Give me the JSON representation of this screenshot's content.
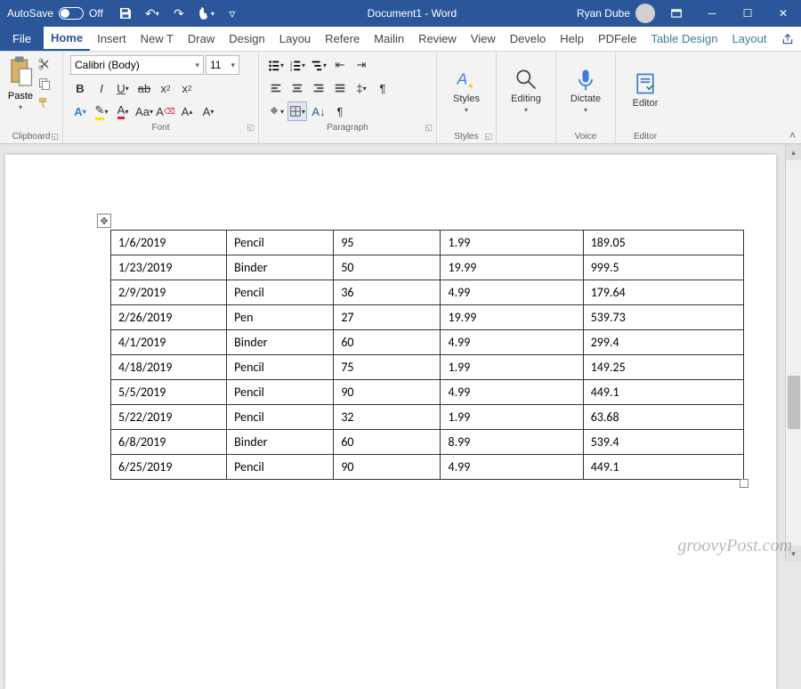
{
  "titlebar": {
    "autosave_label": "AutoSave",
    "autosave_state": "Off",
    "doc_title": "Document1  -  Word",
    "user_name": "Ryan Dube"
  },
  "tabs": {
    "file": "File",
    "items": [
      "Home",
      "Insert",
      "New T",
      "Draw",
      "Design",
      "Layou",
      "Refere",
      "Mailin",
      "Review",
      "View",
      "Develo",
      "Help",
      "PDFele"
    ],
    "contextual": [
      "Table Design",
      "Layout"
    ]
  },
  "ribbon": {
    "clipboard": {
      "paste": "Paste",
      "label": "Clipboard"
    },
    "font": {
      "name": "Calibri (Body)",
      "size": "11",
      "label": "Font"
    },
    "paragraph": {
      "label": "Paragraph"
    },
    "styles": {
      "btn": "Styles",
      "label": "Styles"
    },
    "editing": {
      "btn": "Editing"
    },
    "voice": {
      "btn": "Dictate",
      "label": "Voice"
    },
    "editor": {
      "btn": "Editor",
      "label": "Editor"
    }
  },
  "table": {
    "rows": [
      [
        "1/6/2019",
        "Pencil",
        "95",
        "1.99",
        "189.05"
      ],
      [
        "1/23/2019",
        "Binder",
        "50",
        "19.99",
        "999.5"
      ],
      [
        "2/9/2019",
        "Pencil",
        "36",
        "4.99",
        "179.64"
      ],
      [
        "2/26/2019",
        "Pen",
        "27",
        "19.99",
        "539.73"
      ],
      [
        "4/1/2019",
        "Binder",
        "60",
        "4.99",
        "299.4"
      ],
      [
        "4/18/2019",
        "Pencil",
        "75",
        "1.99",
        "149.25"
      ],
      [
        "5/5/2019",
        "Pencil",
        "90",
        "4.99",
        "449.1"
      ],
      [
        "5/22/2019",
        "Pencil",
        "32",
        "1.99",
        "63.68"
      ],
      [
        "6/8/2019",
        "Binder",
        "60",
        "8.99",
        "539.4"
      ],
      [
        "6/25/2019",
        "Pencil",
        "90",
        "4.99",
        "449.1"
      ]
    ]
  },
  "watermark": "groovyPost.com"
}
